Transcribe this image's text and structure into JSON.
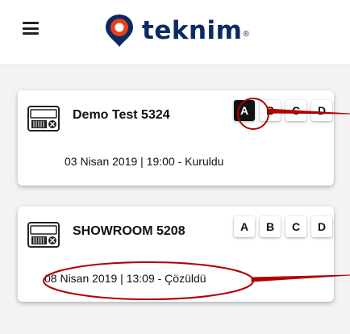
{
  "header": {
    "menu_icon": "hamburger-menu-icon",
    "logo_text": "teknim",
    "logo_mark": "®",
    "brand_color": "#0b2a63",
    "accent_color": "#e8401c"
  },
  "panels": [
    {
      "name": "Demo Test 5324",
      "status": "03 Nisan 2019 | 19:00  -  Kuruldu",
      "zones": [
        "A",
        "B",
        "C",
        "D"
      ],
      "active_zone": "A"
    },
    {
      "name": "SHOWROOM 5208",
      "status": "08 Nisan 2019 | 13:09  -  Çözüldü",
      "zones": [
        "A",
        "B",
        "C",
        "D"
      ],
      "active_zone": null
    }
  ],
  "annotation_color": "#b00000"
}
